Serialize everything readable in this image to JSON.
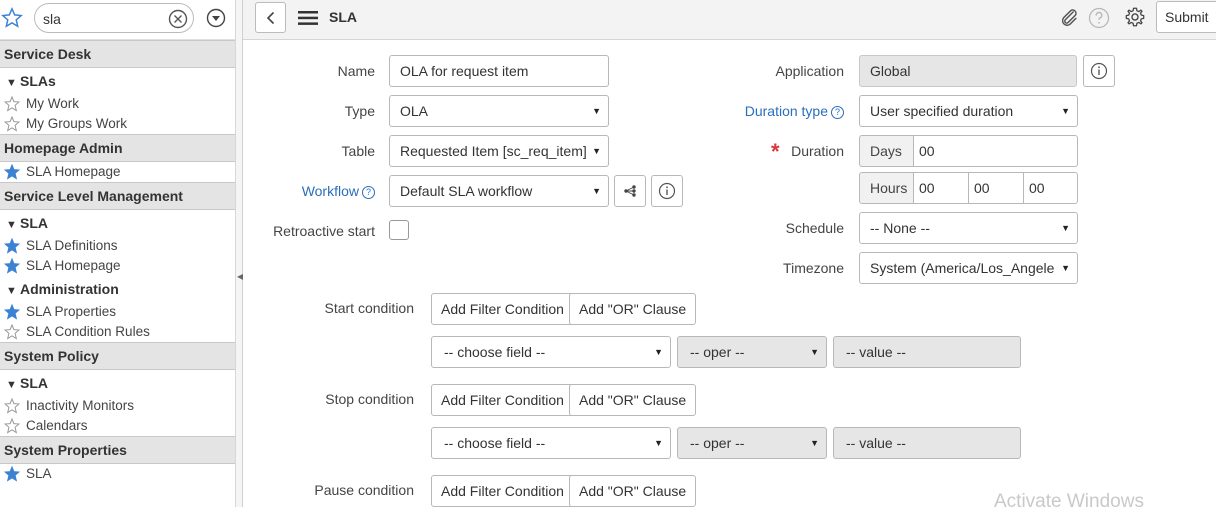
{
  "nav": {
    "filter_value": "sla",
    "sections": [
      {
        "title": "Service Desk"
      },
      {
        "group": "SLAs"
      },
      {
        "item": "My Work",
        "fav": false
      },
      {
        "item": "My Groups Work",
        "fav": false
      },
      {
        "title": "Homepage Admin"
      },
      {
        "item": "SLA Homepage",
        "fav": true
      },
      {
        "title": "Service Level Management"
      },
      {
        "group": "SLA"
      },
      {
        "item": "SLA Definitions",
        "fav": true
      },
      {
        "item": "SLA Homepage",
        "fav": true
      },
      {
        "group": "Administration"
      },
      {
        "item": "SLA Properties",
        "fav": true
      },
      {
        "item": "SLA Condition Rules",
        "fav": false
      },
      {
        "title": "System Policy"
      },
      {
        "group": "SLA"
      },
      {
        "item": "Inactivity Monitors",
        "fav": false
      },
      {
        "item": "Calendars",
        "fav": false
      },
      {
        "title": "System Properties"
      },
      {
        "item": "SLA",
        "fav": true
      }
    ]
  },
  "header": {
    "title": "SLA",
    "submit_label": "Submit"
  },
  "form": {
    "name_label": "Name",
    "name_value": "OLA for  request item",
    "type_label": "Type",
    "type_value": "OLA",
    "table_label": "Table",
    "table_value": "Requested Item [sc_req_item]",
    "workflow_label": "Workflow",
    "workflow_value": "Default SLA workflow",
    "retroactive_label": "Retroactive start",
    "application_label": "Application",
    "application_value": "Global",
    "duration_type_label": "Duration type",
    "duration_type_value": "User specified duration",
    "duration_label": "Duration",
    "days_label": "Days",
    "days_value": "00",
    "hours_label": "Hours",
    "hours_value": "00",
    "minutes_value": "00",
    "seconds_value": "00",
    "schedule_label": "Schedule",
    "schedule_value": "-- None --",
    "timezone_label": "Timezone",
    "timezone_value": "System (America/Los_Angele"
  },
  "conditions": {
    "add_filter_label": "Add Filter Condition",
    "add_or_label": "Add \"OR\" Clause",
    "choose_field": "-- choose field --",
    "oper": "-- oper --",
    "value": "-- value --",
    "start_label": "Start condition",
    "stop_label": "Stop condition",
    "pause_label": "Pause condition"
  },
  "watermark": "Activate Windows",
  "colors": {
    "link": "#2a6ebb",
    "favorite_star": "#3b82d4",
    "required": "#d9363e"
  }
}
